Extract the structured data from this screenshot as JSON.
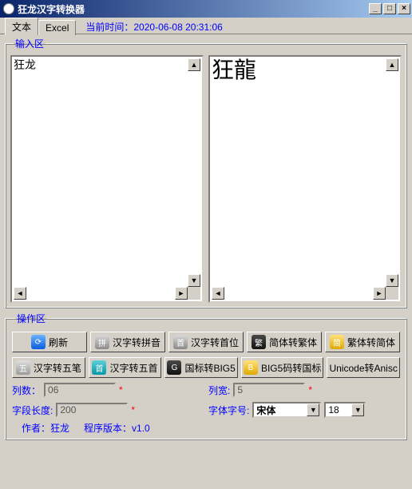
{
  "window": {
    "title": "狂龙汉字转换器",
    "min": "_",
    "max": "□",
    "close": "×"
  },
  "tabs": {
    "text": "文本",
    "excel": "Excel"
  },
  "time": {
    "label": "当前时间：",
    "value": "2020-06-08  20:31:06"
  },
  "input_group": {
    "legend": "输入区",
    "input_text": "狂龙",
    "output_text": "狂龍"
  },
  "ops": {
    "legend": "操作区",
    "row1": {
      "refresh": "刷新",
      "hz2pinyin": "汉字转拼音",
      "hz2shouwei": "汉字转首位",
      "jian2fan": "简体转繁体",
      "fan2jian": "繁体转简体"
    },
    "row2": {
      "hz2wubi": "汉字转五笔",
      "hz2wushou": "汉字转五首",
      "gb2big5": "国标转BIG5",
      "big52gb": "BIG5码转国标",
      "unicode2anisc": "Unicode转Anisc"
    }
  },
  "fields": {
    "cols_label": "列数：",
    "cols_value": "06",
    "colw_label": "列宽:",
    "colw_value": "5",
    "seglen_label": "字段长度:",
    "seglen_value": "200",
    "fontname_label": "字体字号:",
    "fontname_value": "宋体",
    "fontsize_value": "18",
    "asterisk": "*"
  },
  "footer": {
    "author_label": "作者：",
    "author_value": "狂龙",
    "version_label": "程序版本：",
    "version_value": "v1.0"
  }
}
